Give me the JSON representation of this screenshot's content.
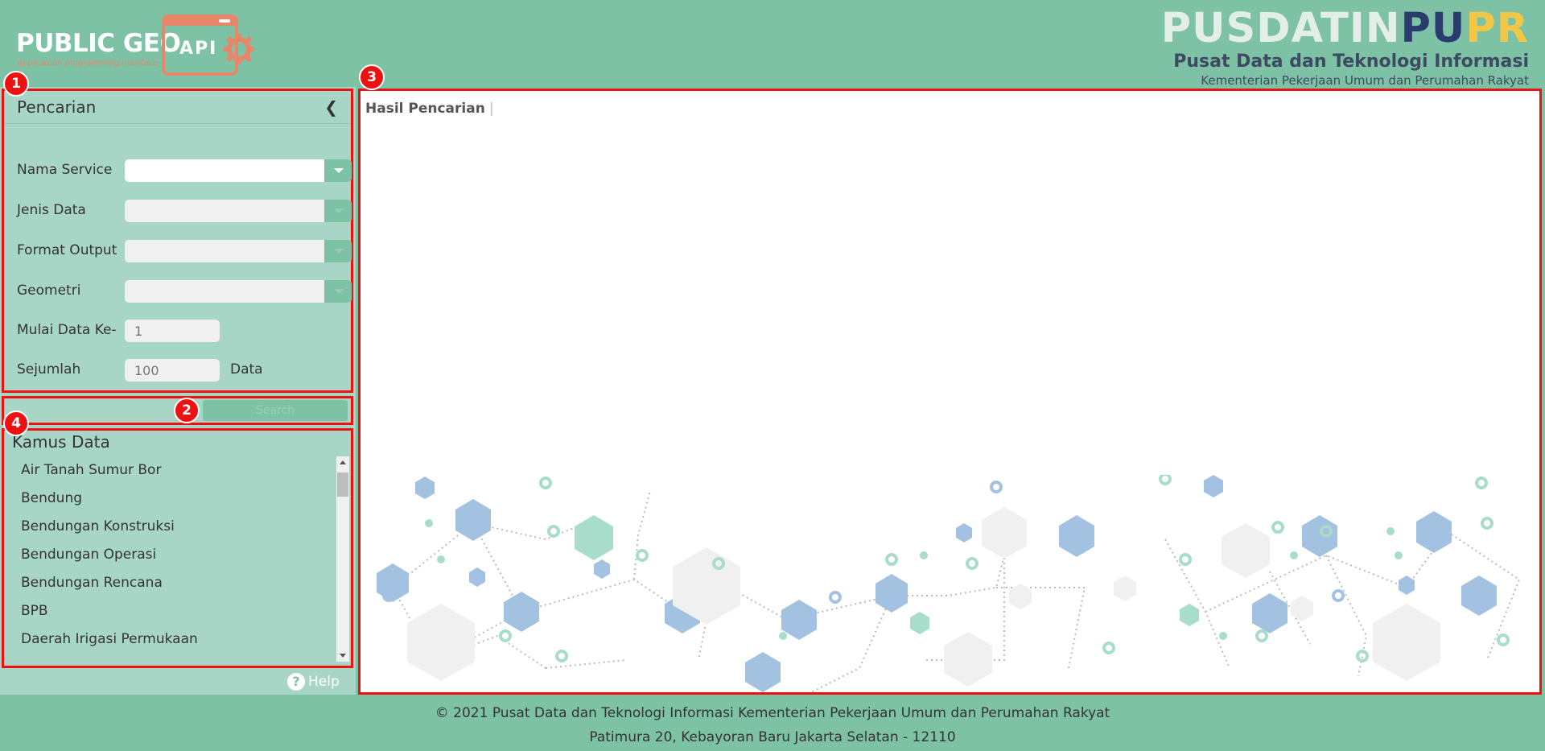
{
  "header": {
    "logo_main": "PUBLIC GEO",
    "logo_sub": "application programming interface",
    "logo_api": "API",
    "pusdatin_w": "PUSDATIN",
    "pusdatin_pu": "PU",
    "pusdatin_pr": "PR",
    "pusdatin_line2": "Pusat Data dan Teknologi Informasi",
    "pusdatin_line3": "Kementerian Pekerjaan Umum dan Perumahan Rakyat"
  },
  "search_panel": {
    "title": "Pencarian",
    "collapse_icon": "chevron-left-icon",
    "fields": {
      "nama_service": "Nama Service",
      "jenis_data": "Jenis Data",
      "format_output": "Format Output",
      "geometri": "Geometri",
      "mulai": "Mulai Data Ke-",
      "mulai_value": "1",
      "sejumlah": "Sejumlah",
      "sejumlah_value": "100",
      "sejumlah_unit": "Data"
    },
    "search_button": "Search"
  },
  "results_panel": {
    "title": "Hasil Pencarian",
    "separator": "|"
  },
  "kamus": {
    "title": "Kamus Data",
    "items": [
      "Air Tanah Sumur Bor",
      "Bendung",
      "Bendungan Konstruksi",
      "Bendungan Operasi",
      "Bendungan Rencana",
      "BPB",
      "Daerah Irigasi Permukaan"
    ]
  },
  "help": "Help",
  "footer": {
    "line1": "© 2021 Pusat Data dan Teknologi Informasi Kementerian Pekerjaan Umum dan Perumahan Rakyat",
    "line2": "Patimura 20, Kebayoran Baru Jakarta Selatan - 12110"
  },
  "annotations": [
    "1",
    "2",
    "3",
    "4"
  ],
  "colors": {
    "primary": "#7ec2a6",
    "panel": "#a8d6c6",
    "highlight": "#ee1111",
    "accent": "#e8866a"
  }
}
